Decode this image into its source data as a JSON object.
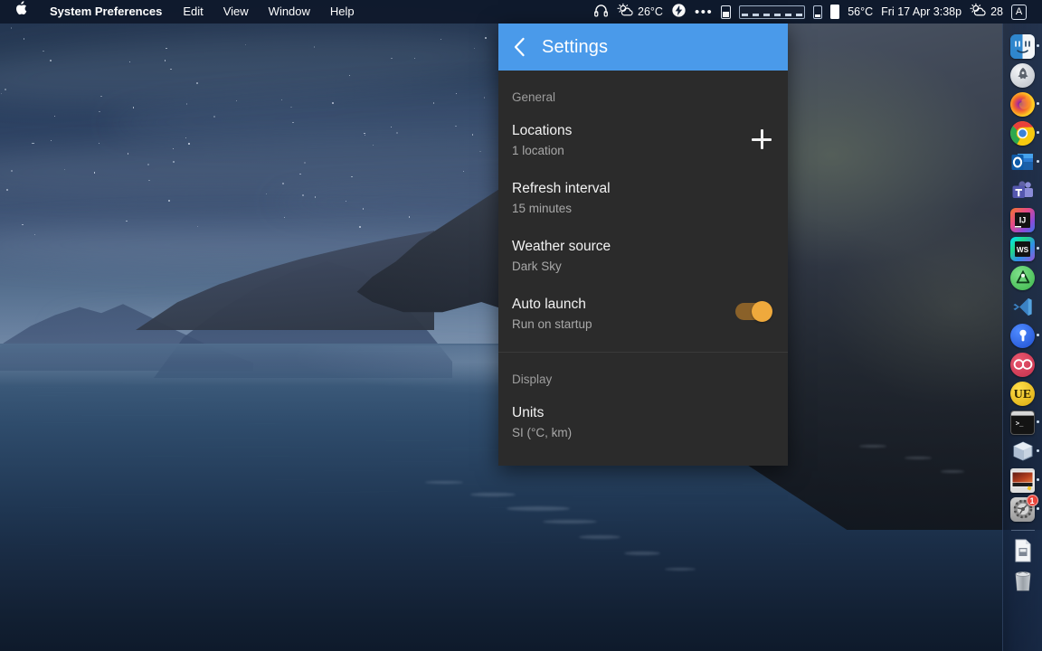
{
  "menubar": {
    "apple_logo": "&#63743;",
    "items": [
      {
        "label": "System Preferences",
        "bold": true
      },
      {
        "label": "Edit",
        "bold": false
      },
      {
        "label": "View",
        "bold": false
      },
      {
        "label": "Window",
        "bold": false
      },
      {
        "label": "Help",
        "bold": false
      }
    ],
    "status": {
      "headphones_icon": "headphones-icon",
      "weather_icon": "sun-behind-cloud-icon",
      "weather_temp": "26°C",
      "bolt_icon": "lightning-bolt-icon",
      "overflow_dots": "•••",
      "battery_small_icon": "battery-small-icon",
      "battery_wide_icon": "battery-wide-icon",
      "battery_narrow_icon": "battery-narrow-icon",
      "battery_solid_icon": "battery-solid-icon",
      "cpu_temp": "56°C",
      "datetime": "Fri 17 Apr 3:38p",
      "weather2_icon": "sun-behind-cloud-icon",
      "weather2_value": "28",
      "input_source": "A"
    }
  },
  "panel": {
    "title": "Settings",
    "back_icon": "back-chevron-icon",
    "accent_color": "#4a9aea",
    "background_color": "#2b2b2b",
    "sections": [
      {
        "header": "General",
        "rows": [
          {
            "title": "Locations",
            "subtitle": "1 location",
            "accessory": "plus-icon"
          },
          {
            "title": "Refresh interval",
            "subtitle": "15 minutes",
            "accessory": "none"
          },
          {
            "title": "Weather source",
            "subtitle": "Dark Sky",
            "accessory": "none"
          },
          {
            "title": "Auto launch",
            "subtitle": "Run on startup",
            "accessory": "toggle",
            "toggle_on": true,
            "toggle_color": "#efa93c"
          }
        ]
      },
      {
        "header": "Display",
        "rows": [
          {
            "title": "Units",
            "subtitle": "SI (°C, km)",
            "accessory": "none"
          }
        ]
      }
    ]
  },
  "dock": {
    "items": [
      {
        "name": "finder",
        "label": "Finder",
        "running": true
      },
      {
        "name": "launchpad",
        "label": "Launchpad",
        "running": false
      },
      {
        "name": "firefox",
        "label": "Firefox",
        "running": true
      },
      {
        "name": "chrome",
        "label": "Google Chrome",
        "running": true
      },
      {
        "name": "outlook",
        "label": "Outlook",
        "running": true
      },
      {
        "name": "teams",
        "label": "Microsoft Teams",
        "running": false
      },
      {
        "name": "intellij",
        "label": "IntelliJ IDEA",
        "running": false
      },
      {
        "name": "webstorm",
        "label": "WebStorm",
        "running": true
      },
      {
        "name": "android-studio",
        "label": "Android Studio",
        "running": false
      },
      {
        "name": "vscode",
        "label": "Visual Studio Code",
        "running": false
      },
      {
        "name": "onepassword",
        "label": "1Password",
        "running": true
      },
      {
        "name": "ringcentral",
        "label": "RingCentral",
        "running": false
      },
      {
        "name": "ultraedit",
        "label": "UltraEdit",
        "running": false
      },
      {
        "name": "terminal",
        "label": "Terminal",
        "running": true
      },
      {
        "name": "virtualbox",
        "label": "VirtualBox",
        "running": true
      },
      {
        "name": "parallels",
        "label": "Parallels Desktop",
        "running": true
      },
      {
        "name": "system-preferences",
        "label": "System Preferences",
        "running": true,
        "badge": "1"
      }
    ],
    "trash_items": [
      {
        "name": "document",
        "label": "Document"
      },
      {
        "name": "trash",
        "label": "Trash"
      }
    ]
  },
  "desktop": {
    "wallpaper_name": "Catalina Coast at Dusk"
  }
}
